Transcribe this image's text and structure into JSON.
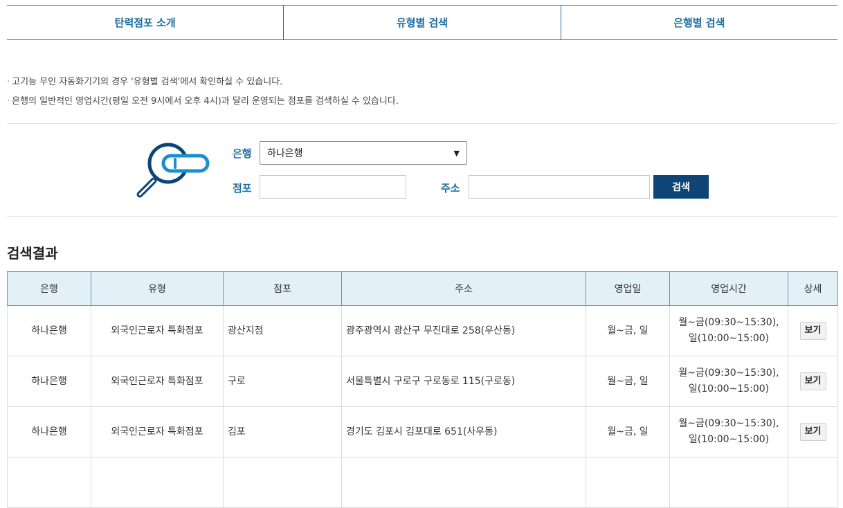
{
  "tabs": [
    {
      "label": "탄력점포 소개"
    },
    {
      "label": "유형별 검색"
    },
    {
      "label": "은행별 검색"
    }
  ],
  "notes": [
    "고기능 무인 자동화기기의 경우 '유형별 검색'에서 확인하실 수 있습니다.",
    "은행의 일반적인 영업시간(평일 오전 9시에서 오후 4시)과 달리 운영되는 점포를 검색하실 수 있습니다."
  ],
  "search": {
    "bank_label": "은행",
    "bank_value": "하나은행",
    "branch_label": "점포",
    "branch_value": "",
    "address_label": "주소",
    "address_value": "",
    "button_label": "검색"
  },
  "results": {
    "title": "검색결과",
    "headers": [
      "은행",
      "유형",
      "점포",
      "주소",
      "영업일",
      "영업시간",
      "상세"
    ],
    "rows": [
      {
        "bank": "하나은행",
        "type": "외국인근로자 특화점포",
        "branch": "광산지점",
        "address": "광주광역시 광산구 무진대로 258(우산동)",
        "days": "월~금, 일",
        "hours": "월~금(09:30~15:30),\n일(10:00~15:00)",
        "detail": "보기"
      },
      {
        "bank": "하나은행",
        "type": "외국인근로자 특화점포",
        "branch": "구로",
        "address": "서울특별시 구로구 구로동로 115(구로동)",
        "days": "월~금, 일",
        "hours": "월~금(09:30~15:30),\n일(10:00~15:00)",
        "detail": "보기"
      },
      {
        "bank": "하나은행",
        "type": "외국인근로자 특화점포",
        "branch": "김포",
        "address": "경기도 김포시 김포대로 651(사우동)",
        "days": "월~금, 일",
        "hours": "월~금(09:30~15:30),\n일(10:00~15:00)",
        "detail": "보기"
      },
      {
        "bank": "",
        "type": "",
        "branch": "",
        "address": "",
        "days": "",
        "hours": "",
        "detail": ""
      }
    ]
  },
  "colors": {
    "accent": "#1a6fa0",
    "button": "#0e4576",
    "header_bg": "#e4f0f7"
  },
  "icons": {
    "magnifier": "magnifier-card-icon",
    "select_arrow": "chevron-down-icon"
  }
}
